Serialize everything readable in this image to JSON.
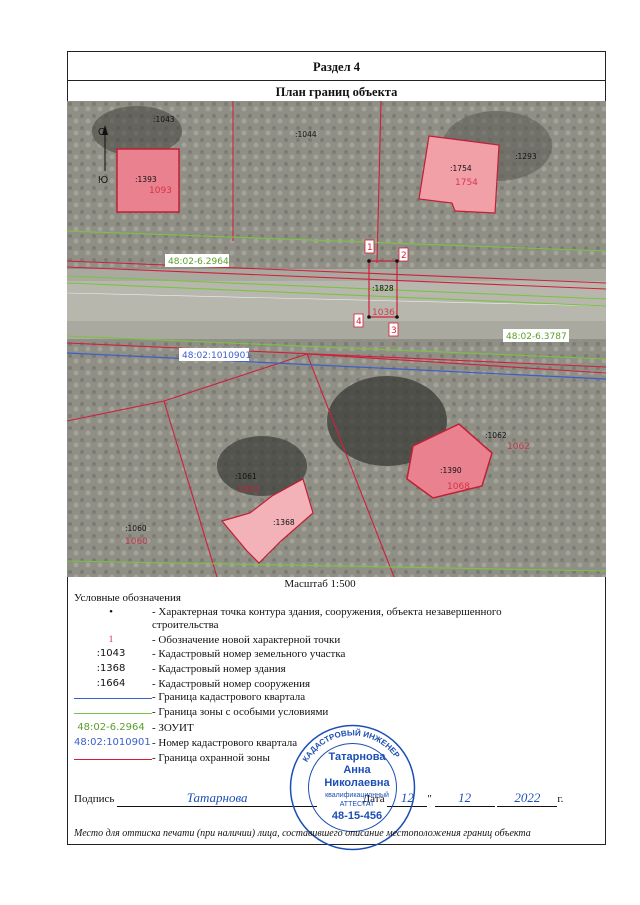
{
  "section_title": "Раздел 4",
  "plan_title": "План границ объекта",
  "map": {
    "compass": {
      "north": "С",
      "south": "Ю"
    },
    "parcel_labels": [
      ":1043",
      ":1044",
      ":1293",
      ":1828",
      ":1062",
      ":1061",
      ":1060"
    ],
    "parcel_labels_red": [
      "1093",
      "1754",
      "1036",
      "1062",
      "1061",
      "1060",
      "1068"
    ],
    "building_labels": [
      ":1393",
      ":1754",
      ":1390",
      ":1368"
    ],
    "zone_labels": [
      "48:02-6.2964",
      "48:02-6.3787"
    ],
    "quarter_label": "48:02:1010901",
    "point_labels": [
      "1",
      "2",
      "3",
      "4"
    ]
  },
  "scale": "Масштаб 1:500",
  "legend": {
    "title": "Условные обозначения",
    "items": [
      {
        "symbol": "•",
        "text": "- Характерная точка контура здания, сооружения, объекта незавершенного строительства"
      },
      {
        "symbol": "1",
        "text": "- Обозначение новой характерной точки"
      },
      {
        "symbol": ":1043",
        "text": "- Кадастровый номер земельного участка"
      },
      {
        "symbol": ":1368",
        "text": "- Кадастровый номер здания"
      },
      {
        "symbol": ":1664",
        "text": "- Кадастровый номер сооружения"
      },
      {
        "symbol": "",
        "text": "- Граница кадастрового квартала"
      },
      {
        "symbol": "",
        "text": "- Граница зоны с особыми условиями"
      },
      {
        "symbol": "48:02-6.2964",
        "text": "- ЗОУИТ"
      },
      {
        "symbol": "48:02:1010901",
        "text": "- Номер кадастрового квартала"
      },
      {
        "symbol": "",
        "text": "- Граница охранной зоны"
      }
    ]
  },
  "signature": {
    "label": "Подпись",
    "handwritten": "Татарнова",
    "date_label": "Дата",
    "day": "12",
    "month": "12",
    "year": "2022",
    "year_suffix": "г."
  },
  "stamp": {
    "name_line1": "Татарнова",
    "name_line2": "Анна",
    "name_line3": "Николаевна",
    "ring_text": "КАДАСТРОВЫЙ ИНЖЕНЕР",
    "cert_line1": "квалификационный",
    "cert_line2": "АТТЕСТАТ",
    "cert_number": "48-15-456"
  },
  "footer": "Место для оттиска печати (при наличии) лица, составившего описание местоположения границ объекта",
  "colors": {
    "quarter_boundary": "#3a5fcd",
    "zone_boundary": "#7cc242",
    "protect_zone": "#d11f3a",
    "building_fill": "#e9828e",
    "stamp_blue": "#1c4fb5"
  }
}
